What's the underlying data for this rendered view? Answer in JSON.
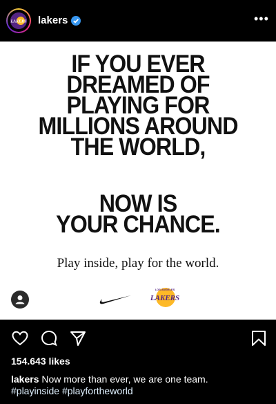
{
  "account": {
    "username": "lakers",
    "avatar_icon": "lakers-logo-icon",
    "verified_icon": "verified-badge-icon"
  },
  "header": {
    "more_label": "•••"
  },
  "post": {
    "headline": "IF YOU EVER\nDREAMED OF\nPLAYING FOR\nMILLIONS AROUND\nTHE WORLD,",
    "headline2": "NOW IS\nYOUR CHANCE.",
    "tagline": "Play inside, play for the world.",
    "logo_text": "LAKERS",
    "logo_subtext": "LOS ANGELES"
  },
  "actions": {
    "like_icon": "heart-icon",
    "comment_icon": "comment-icon",
    "share_icon": "send-icon",
    "save_icon": "bookmark-icon"
  },
  "likes": "154.643 likes",
  "caption": {
    "username": "lakers",
    "text": "Now more than ever, we are one team.",
    "hashtag1": "#playinside",
    "hashtag2": "#playfortheworld"
  },
  "colors": {
    "lakers_purple": "#552583",
    "lakers_gold": "#FDB927",
    "verified_blue": "#3897f0"
  }
}
